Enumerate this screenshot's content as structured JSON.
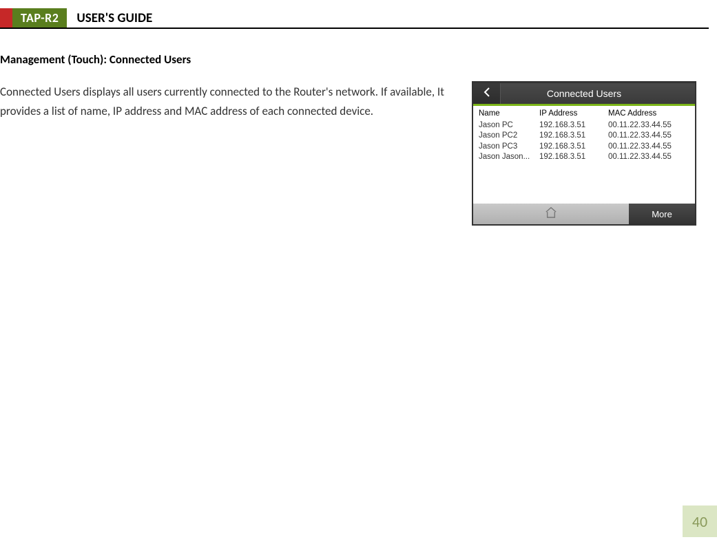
{
  "header": {
    "product": "TAP-R2",
    "title": "USER'S GUIDE"
  },
  "section_heading": "Management (Touch): Connected Users",
  "body_text": "Connected Users displays all users currently connected to the Router's network. If available, It provides a list of name, IP address and MAC address of each connected device.",
  "screenshot": {
    "title": "Connected Users",
    "columns": {
      "name": "Name",
      "ip": "IP Address",
      "mac": "MAC Address"
    },
    "rows": [
      {
        "name": "Jason PC",
        "ip": "192.168.3.51",
        "mac": "00.11.22.33.44.55"
      },
      {
        "name": "Jason PC2",
        "ip": "192.168.3.51",
        "mac": "00.11.22.33.44.55"
      },
      {
        "name": "Jason PC3",
        "ip": "192.168.3.51",
        "mac": "00.11.22.33.44.55"
      },
      {
        "name": "Jason Jason...",
        "ip": "192.168.3.51",
        "mac": "00.11.22.33.44.55"
      }
    ],
    "more_label": "More"
  },
  "page_number": "40"
}
